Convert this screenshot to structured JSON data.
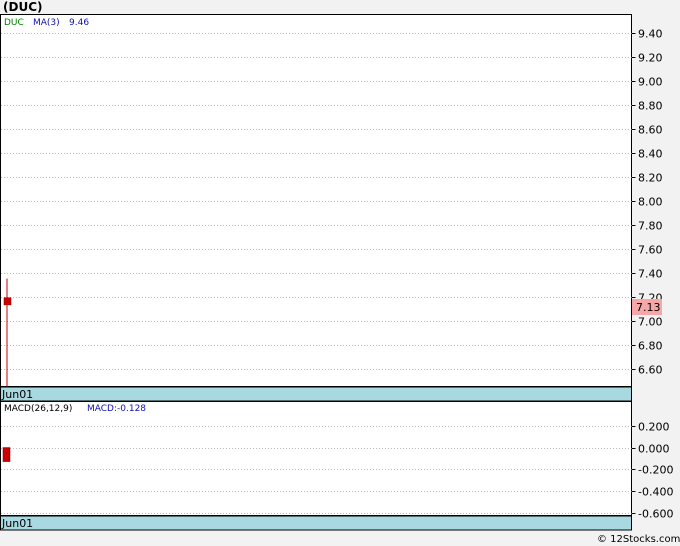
{
  "page_title": "(DUC)",
  "footer_text": "© 12Stocks.com",
  "date_label": "Jun01",
  "price_legend": {
    "symbol": "DUC",
    "ma_label": "MA(3)",
    "ma_value": "9.46"
  },
  "macd_legend": {
    "label": "MACD(26,12,9)",
    "value_label": "MACD:-0.128"
  },
  "colors": {
    "symbol": "#008000",
    "ma": "#1010b0",
    "candle": "#cc0000",
    "last_badge_bg": "#f6a7a7",
    "date_bar": "#a8d8e0",
    "grid": "#b8b8b8"
  },
  "chart_data": [
    {
      "type": "candlestick",
      "title": "(DUC)",
      "ylim": [
        6.45,
        9.55
      ],
      "yticks": [
        "9.40",
        "9.20",
        "9.00",
        "8.80",
        "8.60",
        "8.40",
        "8.20",
        "8.00",
        "7.80",
        "7.60",
        "7.40",
        "7.20",
        "7.00",
        "6.80",
        "6.60"
      ],
      "x": [
        "Jun01"
      ],
      "candles": [
        {
          "date": "Jun01",
          "open": 7.19,
          "high": 7.35,
          "low": 6.45,
          "close": 7.13
        }
      ],
      "last_value": "7.13",
      "grid": true
    },
    {
      "type": "bar",
      "title": "MACD(26,12,9)",
      "ylim": [
        -0.62,
        0.42
      ],
      "yticks": [
        "0.200",
        "0.000",
        "-0.200",
        "-0.400",
        "-0.600"
      ],
      "x": [
        "Jun01"
      ],
      "series": [
        {
          "name": "MACD",
          "values": [
            -0.128
          ]
        }
      ],
      "grid": true
    }
  ]
}
